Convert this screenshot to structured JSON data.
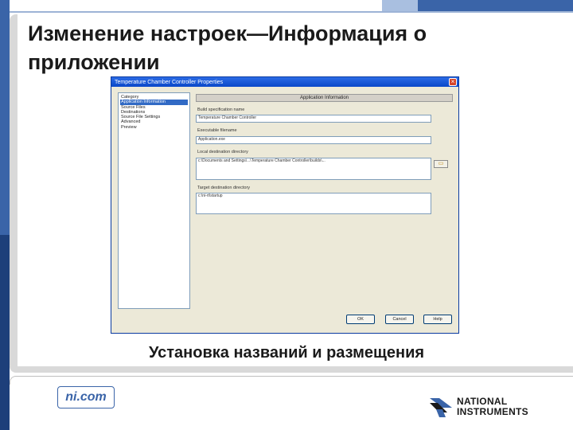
{
  "slide": {
    "title": "Изменение настроек—Информация о приложении",
    "caption": "Установка названий и размещения",
    "footer_site": "ni.com",
    "logo_line1": "NATIONAL",
    "logo_line2": "INSTRUMENTS"
  },
  "dialog": {
    "title": "Temperature Chamber Controller Properties",
    "close_glyph": "×",
    "category_items": [
      "Category",
      "Application Information",
      "Source Files",
      "Destinations",
      "Source File Settings",
      "Advanced",
      "Preview"
    ],
    "selected_category": "Application Information",
    "panel_header": "Application Information",
    "fields": {
      "build_name_label": "Build specification name",
      "build_name_value": "Temperature Chamber Controller",
      "exe_name_label": "Executable filename",
      "exe_name_value": "Application.exe",
      "local_dest_label": "Local destination directory",
      "local_dest_value": "c:\\Documents and Settings\\...\\Temperature Chamber Controller\\builds\\...",
      "target_dest_label": "Target destination directory",
      "target_dest_value": "c:\\ni-rt\\startup"
    },
    "browse_icon": "folder-icon",
    "buttons": {
      "ok": "OK",
      "cancel": "Cancel",
      "help": "Help"
    }
  },
  "colors": {
    "brand_blue": "#3a64a8",
    "window_titlebar": "#0a47c8",
    "window_face": "#ece9d8"
  }
}
